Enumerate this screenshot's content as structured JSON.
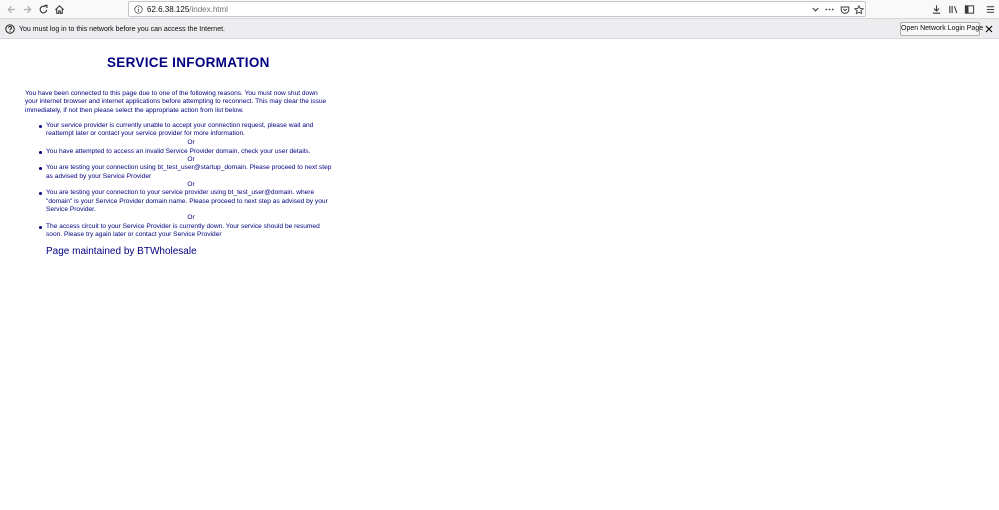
{
  "browser": {
    "url_host": "62.6.38.125",
    "url_path": "/index.html"
  },
  "notification": {
    "message": "You must log in to this network before you can access the Internet.",
    "button_label": "Open Network Login Page"
  },
  "page": {
    "title": "SERVICE INFORMATION",
    "intro": "You have been connected to this page due to one of the following reasons. You must now shut down your internet browser and internet applications before attempting to reconnect. This may clear the issue immediately, if not then please select the appropriate action from list below.",
    "separator": "Or",
    "reasons": [
      "Your service provider is currently unable to accept your connection request, please wait and reattempt later or contact your service provider for more information.",
      "You have attempted to access an invalid Service Provider domain, check your user details.",
      "You are testing your connection using bt_test_user@startup_domain. Please proceed to next step as advised by your Service Provider",
      "You are testing your connection to your service provider using bt_test_user@domain. where \"domain\" is your Service Provider domain name. Please proceed to next step as advised by your Service Provider.",
      "The access circuit to your Service Provider is currently down. Your service should be resumed soon. Please try again later or contact your Service Provider"
    ],
    "footer": "Page maintained by BTWholesale"
  }
}
